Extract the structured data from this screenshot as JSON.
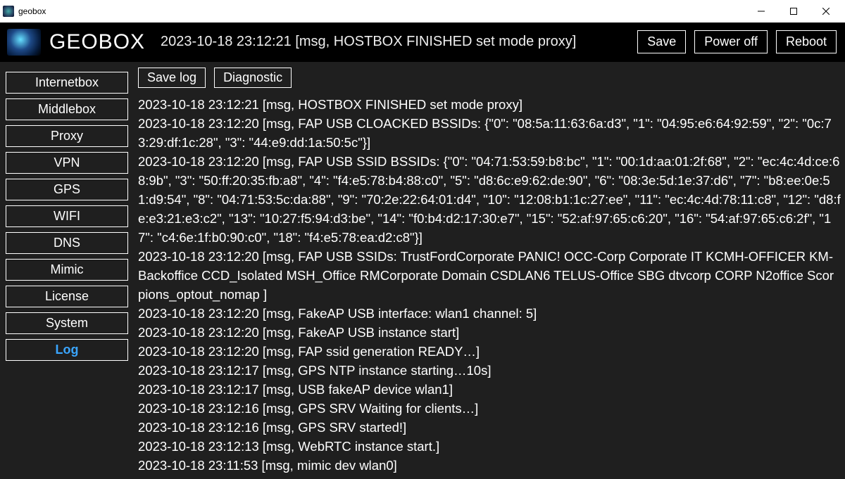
{
  "window": {
    "title": "geobox"
  },
  "header": {
    "brand": "GEOBOX",
    "status": "2023-10-18 23:12:21 [msg, HOSTBOX FINISHED set mode proxy]",
    "save": "Save",
    "power_off": "Power off",
    "reboot": "Reboot"
  },
  "sidebar": {
    "items": [
      {
        "label": "Internetbox",
        "active": false
      },
      {
        "label": "Middlebox",
        "active": false
      },
      {
        "label": "Proxy",
        "active": false
      },
      {
        "label": "VPN",
        "active": false
      },
      {
        "label": "GPS",
        "active": false
      },
      {
        "label": "WIFI",
        "active": false
      },
      {
        "label": "DNS",
        "active": false
      },
      {
        "label": "Mimic",
        "active": false
      },
      {
        "label": "License",
        "active": false
      },
      {
        "label": "System",
        "active": false
      },
      {
        "label": "Log",
        "active": true
      }
    ]
  },
  "toolbar": {
    "save_log": "Save log",
    "diagnostic": "Diagnostic"
  },
  "log_lines": [
    "2023-10-18 23:12:21 [msg, HOSTBOX FINISHED set mode proxy]",
    "2023-10-18 23:12:20 [msg, FAP USB CLOACKED BSSIDs: {\"0\": \"08:5a:11:63:6a:d3\", \"1\": \"04:95:e6:64:92:59\", \"2\": \"0c:73:29:df:1c:28\", \"3\": \"44:e9:dd:1a:50:5c\"}]",
    "2023-10-18 23:12:20 [msg, FAP USB SSID BSSIDs: {\"0\": \"04:71:53:59:b8:bc\", \"1\": \"00:1d:aa:01:2f:68\", \"2\": \"ec:4c:4d:ce:68:9b\", \"3\": \"50:ff:20:35:fb:a8\", \"4\": \"f4:e5:78:b4:88:c0\", \"5\": \"d8:6c:e9:62:de:90\", \"6\": \"08:3e:5d:1e:37:d6\", \"7\": \"b8:ee:0e:51:d9:54\", \"8\": \"04:71:53:5c:da:88\", \"9\": \"70:2e:22:64:01:d4\", \"10\": \"12:08:b1:1c:27:ee\", \"11\": \"ec:4c:4d:78:11:c8\", \"12\": \"d8:fe:e3:21:e3:c2\", \"13\": \"10:27:f5:94:d3:be\", \"14\": \"f0:b4:d2:17:30:e7\", \"15\": \"52:af:97:65:c6:20\", \"16\": \"54:af:97:65:c6:2f\", \"17\": \"c4:6e:1f:b0:90:c0\", \"18\": \"f4:e5:78:ea:d2:c8\"}]",
    "2023-10-18 23:12:20 [msg, FAP USB SSIDs: TrustFordCorporate PANIC! OCC-Corp Corporate IT KCMH-OFFICER KM-Backoffice CCD_Isolated MSH_Office RMCorporate Domain CSDLAN6 TELUS-Office SBG dtvcorp CORP N2office Scorpions_optout_nomap ]",
    "2023-10-18 23:12:20 [msg, FakeAP USB interface: wlan1 channel: 5]",
    "2023-10-18 23:12:20 [msg, FakeAP USB instance start]",
    "2023-10-18 23:12:20 [msg, FAP ssid generation READY…]",
    "2023-10-18 23:12:17 [msg, GPS NTP instance starting…10s]",
    "2023-10-18 23:12:17 [msg, USB fakeAP device wlan1]",
    "2023-10-18 23:12:16 [msg, GPS SRV Waiting for clients…]",
    "2023-10-18 23:12:16 [msg, GPS SRV started!]",
    "2023-10-18 23:12:13 [msg, WebRTC instance start.]",
    "2023-10-18 23:11:53 [msg, mimic dev wlan0]"
  ]
}
